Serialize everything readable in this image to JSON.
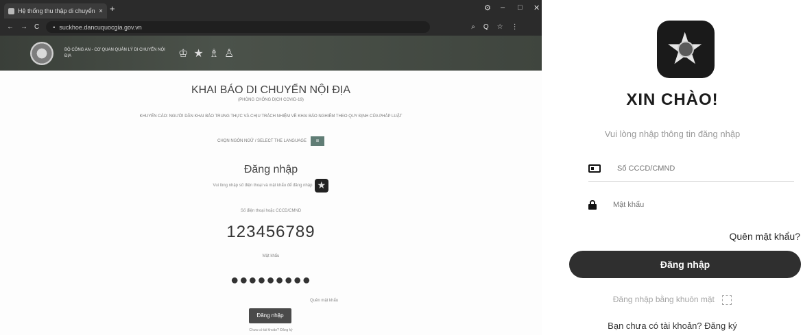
{
  "browser": {
    "tab_title": "Hệ thống thu thập di chuyển",
    "tab_close": "×",
    "new_tab": "+",
    "window_controls": [
      "⚙",
      "–",
      "□",
      "✕"
    ],
    "nav": {
      "back": "←",
      "forward": "→",
      "reload": "C"
    },
    "url": "suckhoe.dancuquocgia.gov.vn",
    "addr_icons": [
      "⌕",
      "Q",
      "☆",
      "⋮"
    ],
    "banner_text": "BỘ CÔNG AN - CƠ QUAN QUẢN LÝ DI CHUYỂN NỘI ĐỊA",
    "medals": [
      "♔",
      "★",
      "♗",
      "♙"
    ]
  },
  "left_page": {
    "title": "KHAI BÁO DI CHUYỂN NỘI ĐỊA",
    "subtitle": "(PHÒNG CHỐNG DỊCH COVID-19)",
    "notice": "KHUYẾN CÁO: NGƯỜI DÂN KHAI BÁO TRUNG THỰC VÀ CHỊU TRÁCH NHIỆM VỀ KHAI BÁO NGHIÊM THEO QUY ĐỊNH CỦA PHÁP LUẬT",
    "language_label": "CHỌN NGÔN NGỮ / SELECT THE LANGUAGE",
    "language_button": "≡",
    "login_heading": "Đăng nhập",
    "login_hint": "Vui lòng nhập số điện thoại và mật khẩu để đăng nhập",
    "phone_label": "Số điện thoại hoặc CCCD/CMND",
    "phone_value": "123456789",
    "password_label": "Mật khẩu",
    "password_value": "●●●●●●●●●",
    "forgot": "Quên mật khẩu",
    "login_button": "Đăng nhập",
    "register": "Chưa có tài khoản? Đăng ký"
  },
  "mobile": {
    "greeting": "XIN CHÀO!",
    "prompt": "Vui lòng nhập thông tin đăng nhập",
    "id_placeholder": "Số CCCD/CMND",
    "password_placeholder": "Mật khẩu",
    "forgot": "Quên mật khẩu?",
    "login_button": "Đăng nhập",
    "face_login": "Đăng nhập bằng khuôn mặt",
    "register": "Bạn chưa có tài khoản? Đăng ký"
  }
}
